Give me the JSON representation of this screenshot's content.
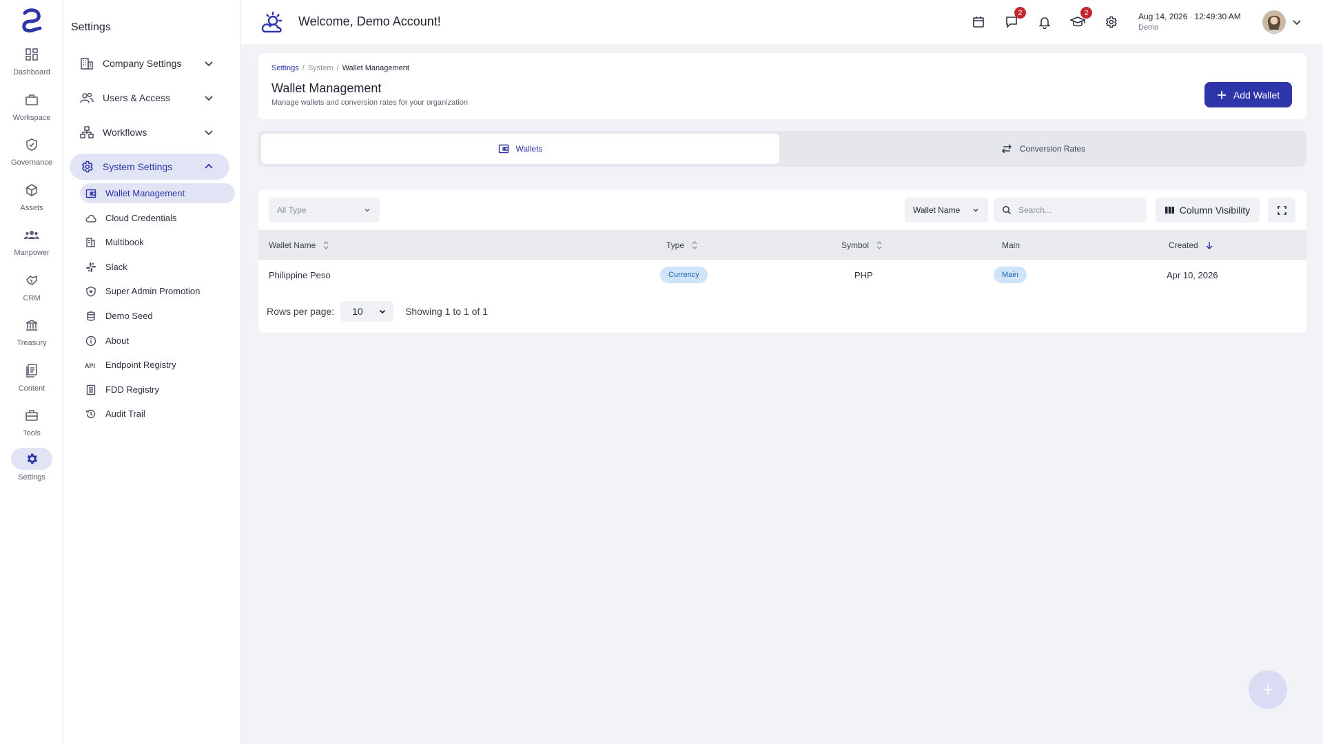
{
  "rail": {
    "items": [
      {
        "label": "Dashboard",
        "icon": "dashboard-icon"
      },
      {
        "label": "Workspace",
        "icon": "briefcase-icon"
      },
      {
        "label": "Governance",
        "icon": "shield-check-icon"
      },
      {
        "label": "Assets",
        "icon": "cube-icon"
      },
      {
        "label": "Manpower",
        "icon": "people-icon"
      },
      {
        "label": "CRM",
        "icon": "handshake-icon"
      },
      {
        "label": "Treasury",
        "icon": "bank-icon"
      },
      {
        "label": "Content",
        "icon": "document-icon"
      },
      {
        "label": "Tools",
        "icon": "toolbox-icon"
      },
      {
        "label": "Settings",
        "icon": "gear-icon",
        "active": true
      }
    ]
  },
  "sidebar": {
    "title": "Settings",
    "groups": [
      {
        "label": "Company Settings",
        "icon": "building-icon"
      },
      {
        "label": "Users & Access",
        "icon": "users-icon"
      },
      {
        "label": "Workflows",
        "icon": "workflow-icon"
      },
      {
        "label": "System Settings",
        "icon": "gear-icon",
        "open": true
      }
    ],
    "sub_items": [
      {
        "label": "Wallet Management",
        "icon": "wallet-icon",
        "active": true
      },
      {
        "label": "Cloud Credentials",
        "icon": "cloud-icon"
      },
      {
        "label": "Multibook",
        "icon": "books-icon"
      },
      {
        "label": "Slack",
        "icon": "slack-icon"
      },
      {
        "label": "Super Admin Promotion",
        "icon": "shield-star-icon"
      },
      {
        "label": "Demo Seed",
        "icon": "database-icon"
      },
      {
        "label": "About",
        "icon": "info-icon"
      },
      {
        "label": "Endpoint Registry",
        "icon": "api-icon"
      },
      {
        "label": "FDD Registry",
        "icon": "list-icon"
      },
      {
        "label": "Audit Trail",
        "icon": "history-icon"
      }
    ]
  },
  "topbar": {
    "welcome": "Welcome, Demo Account!",
    "messages_badge": "2",
    "learning_badge": "2",
    "date": "Aug 14, 2026",
    "time": "12:49:30 AM",
    "company": "Demo"
  },
  "header": {
    "breadcrumb": [
      "Settings",
      "System",
      "Wallet Management"
    ],
    "title": "Wallet Management",
    "subtitle": "Manage wallets and conversion rates for your organization",
    "add_button": "Add Wallet"
  },
  "tabs": [
    {
      "label": "Wallets",
      "active": true
    },
    {
      "label": "Conversion Rates",
      "active": false
    }
  ],
  "toolbar": {
    "type_filter": "All Type",
    "column_select": "Wallet Name",
    "search_placeholder": "Search...",
    "column_visibility": "Column Visibility"
  },
  "table": {
    "columns": [
      "Wallet Name",
      "Type",
      "Symbol",
      "Main",
      "Created"
    ],
    "rows": [
      {
        "wallet_name": "Philippine Peso",
        "type": "Currency",
        "symbol": "PHP",
        "main": "Main",
        "created": "Apr 10, 2026"
      }
    ]
  },
  "pagination": {
    "rows_per_page_label": "Rows per page:",
    "rows_per_page": "10",
    "showing": "Showing 1 to 1 of 1"
  },
  "colors": {
    "accent": "#2d35a8",
    "badge": "#c3272b",
    "pill_bg": "#cfe4f8",
    "pill_text": "#1e5fb4"
  }
}
